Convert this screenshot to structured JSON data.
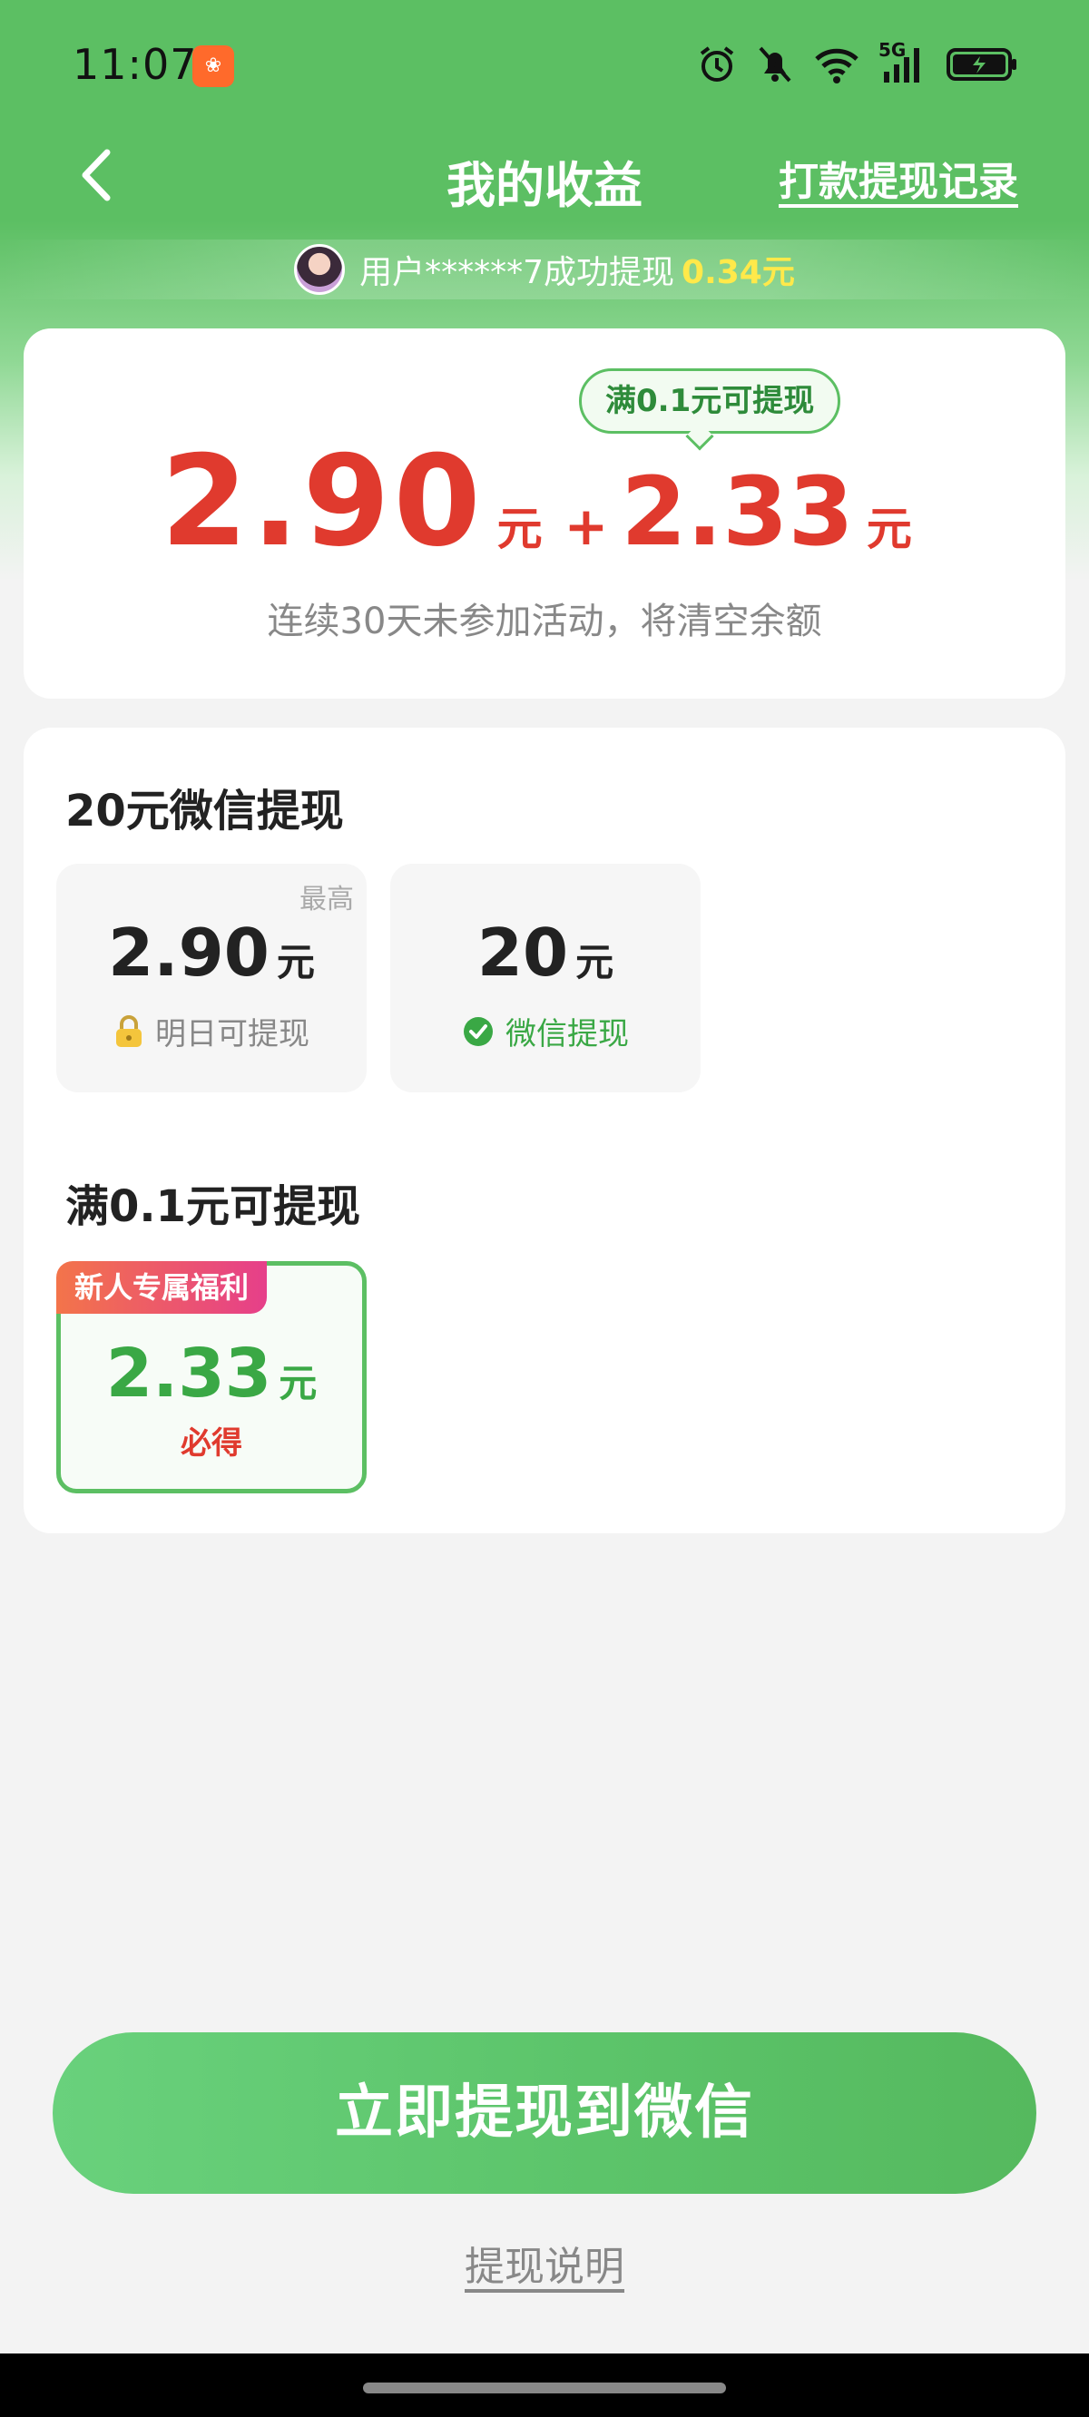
{
  "status_bar": {
    "time": "11:07",
    "network": "5G",
    "icons": [
      "app-notification-icon",
      "alarm-icon",
      "mute-bell-icon",
      "wifi-icon",
      "signal-icon",
      "battery-icon"
    ]
  },
  "header": {
    "title": "我的收益",
    "records_link": "打款提现记录"
  },
  "ticker": {
    "text": "用户******7成功提现",
    "amount": "0.34元"
  },
  "balance": {
    "threshold_bubble": "满0.1元可提现",
    "amount_main": "2.90",
    "unit": "元",
    "plus": "+",
    "amount_bonus": "2.33",
    "note": "连续30天未参加活动，将清空余额"
  },
  "wechat_section": {
    "title": "20元微信提现",
    "options": [
      {
        "corner": "最高",
        "amount": "2.90",
        "unit": "元",
        "sub": "明日可提现",
        "icon": "lock-icon"
      },
      {
        "amount": "20",
        "unit": "元",
        "sub": "微信提现",
        "icon": "wechat-check-icon"
      }
    ]
  },
  "newbie_section": {
    "title": "满0.1元可提现",
    "tag": "新人专属福利",
    "amount": "2.33",
    "unit": "元",
    "sub": "必得"
  },
  "actions": {
    "withdraw_button": "立即提现到微信",
    "explain_link": "提现说明"
  },
  "colors": {
    "brand_green": "#5cbf63",
    "amount_red": "#e03a2e",
    "highlight_yellow": "#ffe94a"
  }
}
